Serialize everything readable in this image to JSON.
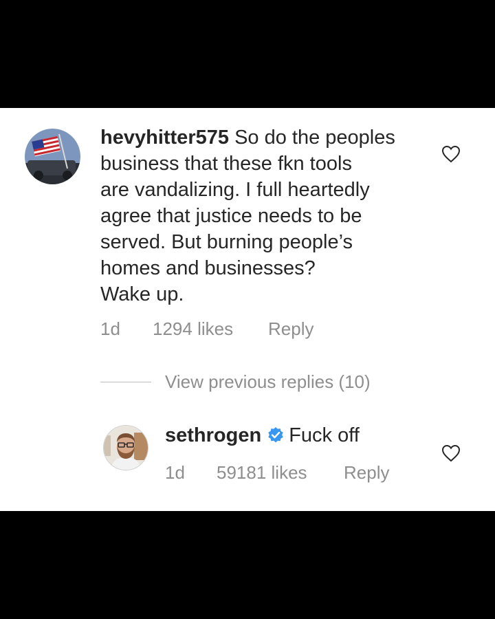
{
  "colors": {
    "background": "#000000",
    "panel": "#ffffff",
    "text": "#262626",
    "muted": "#8e8e8e",
    "verified": "#3897f0"
  },
  "comment": {
    "username": "hevyhitter575",
    "text_lines": [
      "So do the peoples",
      "business that these fkn tools",
      "are vandalizing.  I full heartedly",
      "agree that justice needs to be",
      "served.  But burning people’s",
      "homes and businesses?",
      "Wake up."
    ],
    "time": "1d",
    "likes": "1294 likes",
    "reply_label": "Reply",
    "avatar_icon": "flag-avatar-icon",
    "like_icon": "heart-icon"
  },
  "view_previous": "View previous replies (10)",
  "reply": {
    "username": "sethrogen",
    "verified_icon": "verified-badge-icon",
    "text": "Fuck off",
    "time": "1d",
    "likes": "59181 likes",
    "reply_label": "Reply",
    "avatar_icon": "user-avatar-icon",
    "like_icon": "heart-icon"
  }
}
